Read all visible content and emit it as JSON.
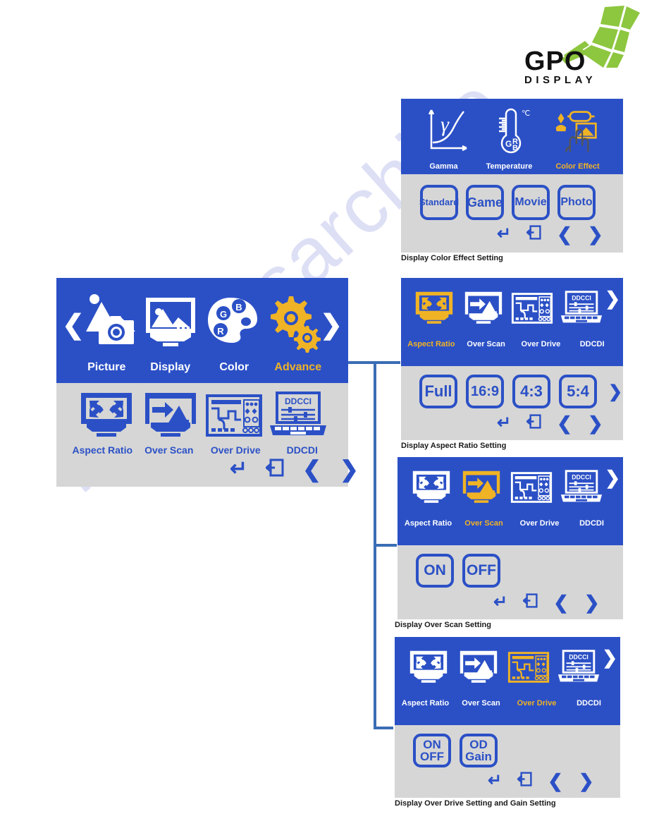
{
  "logo": {
    "name": "GPO",
    "subtitle": "DISPLAY",
    "mark_color": "#8dc63f",
    "text_color": "#111111"
  },
  "watermark": {
    "text": "manualsarchive",
    "color": "#c9cdf0"
  },
  "theme": {
    "osd_blue": "#2b50c6",
    "osd_gray": "#d6d6d6",
    "highlight_gold": "#f0b325",
    "connector_blue": "#3a6db5",
    "caption_color": "#1a1a1a"
  },
  "main_menu": {
    "tabs": [
      {
        "label": "Picture",
        "icon": "picture-camera-mountain-icon",
        "selected": false
      },
      {
        "label": "Display",
        "icon": "monitor-image-icon",
        "selected": false
      },
      {
        "label": "Color",
        "icon": "color-palette-rgb-icon",
        "selected": false
      },
      {
        "label": "Advance",
        "icon": "gears-icon",
        "selected": true
      }
    ],
    "left_arrow": "❮",
    "right_arrow": "❯",
    "submenu": [
      {
        "label": "Aspect Ratio",
        "icon": "aspect-ratio-arrows-monitor-icon",
        "selected": false
      },
      {
        "label": "Over Scan",
        "icon": "over-scan-arrow-picture-icon",
        "selected": false
      },
      {
        "label": "Over Drive",
        "icon": "over-drive-panel-icon",
        "selected": false
      },
      {
        "label": "DDCDI",
        "icon": "ddcci-laptop-icon",
        "selected": false
      }
    ],
    "nav": {
      "enter": "↵",
      "exit": "exit-icon",
      "prev": "❮",
      "next": "❯"
    }
  },
  "panels": [
    {
      "id": "color-effect",
      "caption": "Display Color Effect Setting",
      "tabs": [
        {
          "label": "Gamma",
          "icon": "gamma-curve-icon",
          "selected": false
        },
        {
          "label": "Temperature",
          "icon": "thermometer-icon",
          "selected": false
        },
        {
          "label": "Color Effect",
          "icon": "color-effect-hand-icon",
          "selected": true
        }
      ],
      "has_right_chevron": false,
      "options": [
        "Standard",
        "Game",
        "Movie",
        "Photo"
      ],
      "options_right_chevron": false,
      "nav": {
        "enter": "↵",
        "exit": "exit-icon",
        "prev": "❮",
        "next": "❯"
      }
    },
    {
      "id": "aspect-ratio",
      "caption": "Display Aspect Ratio Setting",
      "tabs": [
        {
          "label": "Aspect Ratio",
          "icon": "aspect-ratio-arrows-monitor-icon",
          "selected": true
        },
        {
          "label": "Over Scan",
          "icon": "over-scan-arrow-picture-icon",
          "selected": false
        },
        {
          "label": "Over Drive",
          "icon": "over-drive-panel-icon",
          "selected": false
        },
        {
          "label": "DDCDI",
          "icon": "ddcci-laptop-icon",
          "selected": false
        }
      ],
      "has_right_chevron": true,
      "options": [
        "Full",
        "16:9",
        "4:3",
        "5:4"
      ],
      "options_right_chevron": true,
      "nav": {
        "enter": "↵",
        "exit": "exit-icon",
        "prev": "❮",
        "next": "❯"
      }
    },
    {
      "id": "over-scan",
      "caption": "Display Over Scan Setting",
      "tabs": [
        {
          "label": "Aspect Ratio",
          "icon": "aspect-ratio-arrows-monitor-icon",
          "selected": false
        },
        {
          "label": "Over Scan",
          "icon": "over-scan-arrow-picture-icon",
          "selected": true
        },
        {
          "label": "Over Drive",
          "icon": "over-drive-panel-icon",
          "selected": false
        },
        {
          "label": "DDCDI",
          "icon": "ddcci-laptop-icon",
          "selected": false
        }
      ],
      "has_right_chevron": true,
      "options": [
        "ON",
        "OFF"
      ],
      "options_right_chevron": false,
      "nav": {
        "enter": "↵",
        "exit": "exit-icon",
        "prev": "❮",
        "next": "❯"
      }
    },
    {
      "id": "over-drive",
      "caption": "Display Over Drive Setting and Gain Setting",
      "tabs": [
        {
          "label": "Aspect Ratio",
          "icon": "aspect-ratio-arrows-monitor-icon",
          "selected": false
        },
        {
          "label": "Over Scan",
          "icon": "over-scan-arrow-picture-icon",
          "selected": false
        },
        {
          "label": "Over Drive",
          "icon": "over-drive-panel-icon",
          "selected": true
        },
        {
          "label": "DDCDI",
          "icon": "ddcci-laptop-icon",
          "selected": false
        }
      ],
      "has_right_chevron": true,
      "options": [
        "ON\nOFF",
        "OD\nGain"
      ],
      "options_right_chevron": false,
      "nav": {
        "enter": "↵",
        "exit": "exit-icon",
        "prev": "❮",
        "next": "❯"
      }
    }
  ],
  "ddcci_screen_text": "DDCCI"
}
